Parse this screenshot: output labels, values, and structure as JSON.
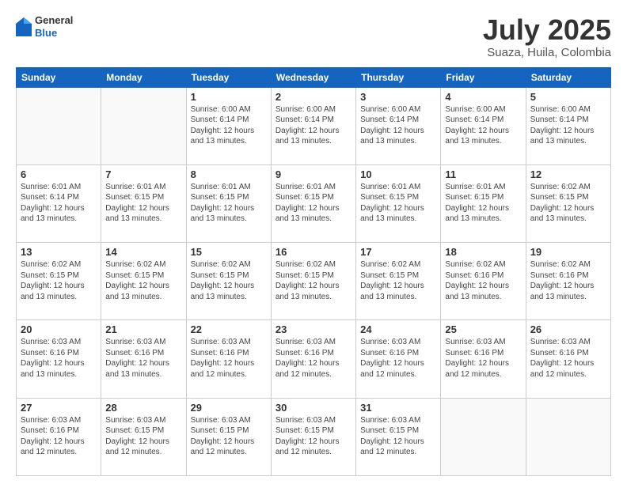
{
  "header": {
    "logo_general": "General",
    "logo_blue": "Blue",
    "title": "July 2025",
    "location": "Suaza, Huila, Colombia"
  },
  "days_of_week": [
    "Sunday",
    "Monday",
    "Tuesday",
    "Wednesday",
    "Thursday",
    "Friday",
    "Saturday"
  ],
  "weeks": [
    [
      {
        "num": "",
        "info": ""
      },
      {
        "num": "",
        "info": ""
      },
      {
        "num": "1",
        "info": "Sunrise: 6:00 AM\nSunset: 6:14 PM\nDaylight: 12 hours\nand 13 minutes."
      },
      {
        "num": "2",
        "info": "Sunrise: 6:00 AM\nSunset: 6:14 PM\nDaylight: 12 hours\nand 13 minutes."
      },
      {
        "num": "3",
        "info": "Sunrise: 6:00 AM\nSunset: 6:14 PM\nDaylight: 12 hours\nand 13 minutes."
      },
      {
        "num": "4",
        "info": "Sunrise: 6:00 AM\nSunset: 6:14 PM\nDaylight: 12 hours\nand 13 minutes."
      },
      {
        "num": "5",
        "info": "Sunrise: 6:00 AM\nSunset: 6:14 PM\nDaylight: 12 hours\nand 13 minutes."
      }
    ],
    [
      {
        "num": "6",
        "info": "Sunrise: 6:01 AM\nSunset: 6:14 PM\nDaylight: 12 hours\nand 13 minutes."
      },
      {
        "num": "7",
        "info": "Sunrise: 6:01 AM\nSunset: 6:15 PM\nDaylight: 12 hours\nand 13 minutes."
      },
      {
        "num": "8",
        "info": "Sunrise: 6:01 AM\nSunset: 6:15 PM\nDaylight: 12 hours\nand 13 minutes."
      },
      {
        "num": "9",
        "info": "Sunrise: 6:01 AM\nSunset: 6:15 PM\nDaylight: 12 hours\nand 13 minutes."
      },
      {
        "num": "10",
        "info": "Sunrise: 6:01 AM\nSunset: 6:15 PM\nDaylight: 12 hours\nand 13 minutes."
      },
      {
        "num": "11",
        "info": "Sunrise: 6:01 AM\nSunset: 6:15 PM\nDaylight: 12 hours\nand 13 minutes."
      },
      {
        "num": "12",
        "info": "Sunrise: 6:02 AM\nSunset: 6:15 PM\nDaylight: 12 hours\nand 13 minutes."
      }
    ],
    [
      {
        "num": "13",
        "info": "Sunrise: 6:02 AM\nSunset: 6:15 PM\nDaylight: 12 hours\nand 13 minutes."
      },
      {
        "num": "14",
        "info": "Sunrise: 6:02 AM\nSunset: 6:15 PM\nDaylight: 12 hours\nand 13 minutes."
      },
      {
        "num": "15",
        "info": "Sunrise: 6:02 AM\nSunset: 6:15 PM\nDaylight: 12 hours\nand 13 minutes."
      },
      {
        "num": "16",
        "info": "Sunrise: 6:02 AM\nSunset: 6:15 PM\nDaylight: 12 hours\nand 13 minutes."
      },
      {
        "num": "17",
        "info": "Sunrise: 6:02 AM\nSunset: 6:15 PM\nDaylight: 12 hours\nand 13 minutes."
      },
      {
        "num": "18",
        "info": "Sunrise: 6:02 AM\nSunset: 6:16 PM\nDaylight: 12 hours\nand 13 minutes."
      },
      {
        "num": "19",
        "info": "Sunrise: 6:02 AM\nSunset: 6:16 PM\nDaylight: 12 hours\nand 13 minutes."
      }
    ],
    [
      {
        "num": "20",
        "info": "Sunrise: 6:03 AM\nSunset: 6:16 PM\nDaylight: 12 hours\nand 13 minutes."
      },
      {
        "num": "21",
        "info": "Sunrise: 6:03 AM\nSunset: 6:16 PM\nDaylight: 12 hours\nand 13 minutes."
      },
      {
        "num": "22",
        "info": "Sunrise: 6:03 AM\nSunset: 6:16 PM\nDaylight: 12 hours\nand 12 minutes."
      },
      {
        "num": "23",
        "info": "Sunrise: 6:03 AM\nSunset: 6:16 PM\nDaylight: 12 hours\nand 12 minutes."
      },
      {
        "num": "24",
        "info": "Sunrise: 6:03 AM\nSunset: 6:16 PM\nDaylight: 12 hours\nand 12 minutes."
      },
      {
        "num": "25",
        "info": "Sunrise: 6:03 AM\nSunset: 6:16 PM\nDaylight: 12 hours\nand 12 minutes."
      },
      {
        "num": "26",
        "info": "Sunrise: 6:03 AM\nSunset: 6:16 PM\nDaylight: 12 hours\nand 12 minutes."
      }
    ],
    [
      {
        "num": "27",
        "info": "Sunrise: 6:03 AM\nSunset: 6:16 PM\nDaylight: 12 hours\nand 12 minutes."
      },
      {
        "num": "28",
        "info": "Sunrise: 6:03 AM\nSunset: 6:15 PM\nDaylight: 12 hours\nand 12 minutes."
      },
      {
        "num": "29",
        "info": "Sunrise: 6:03 AM\nSunset: 6:15 PM\nDaylight: 12 hours\nand 12 minutes."
      },
      {
        "num": "30",
        "info": "Sunrise: 6:03 AM\nSunset: 6:15 PM\nDaylight: 12 hours\nand 12 minutes."
      },
      {
        "num": "31",
        "info": "Sunrise: 6:03 AM\nSunset: 6:15 PM\nDaylight: 12 hours\nand 12 minutes."
      },
      {
        "num": "",
        "info": ""
      },
      {
        "num": "",
        "info": ""
      }
    ]
  ]
}
